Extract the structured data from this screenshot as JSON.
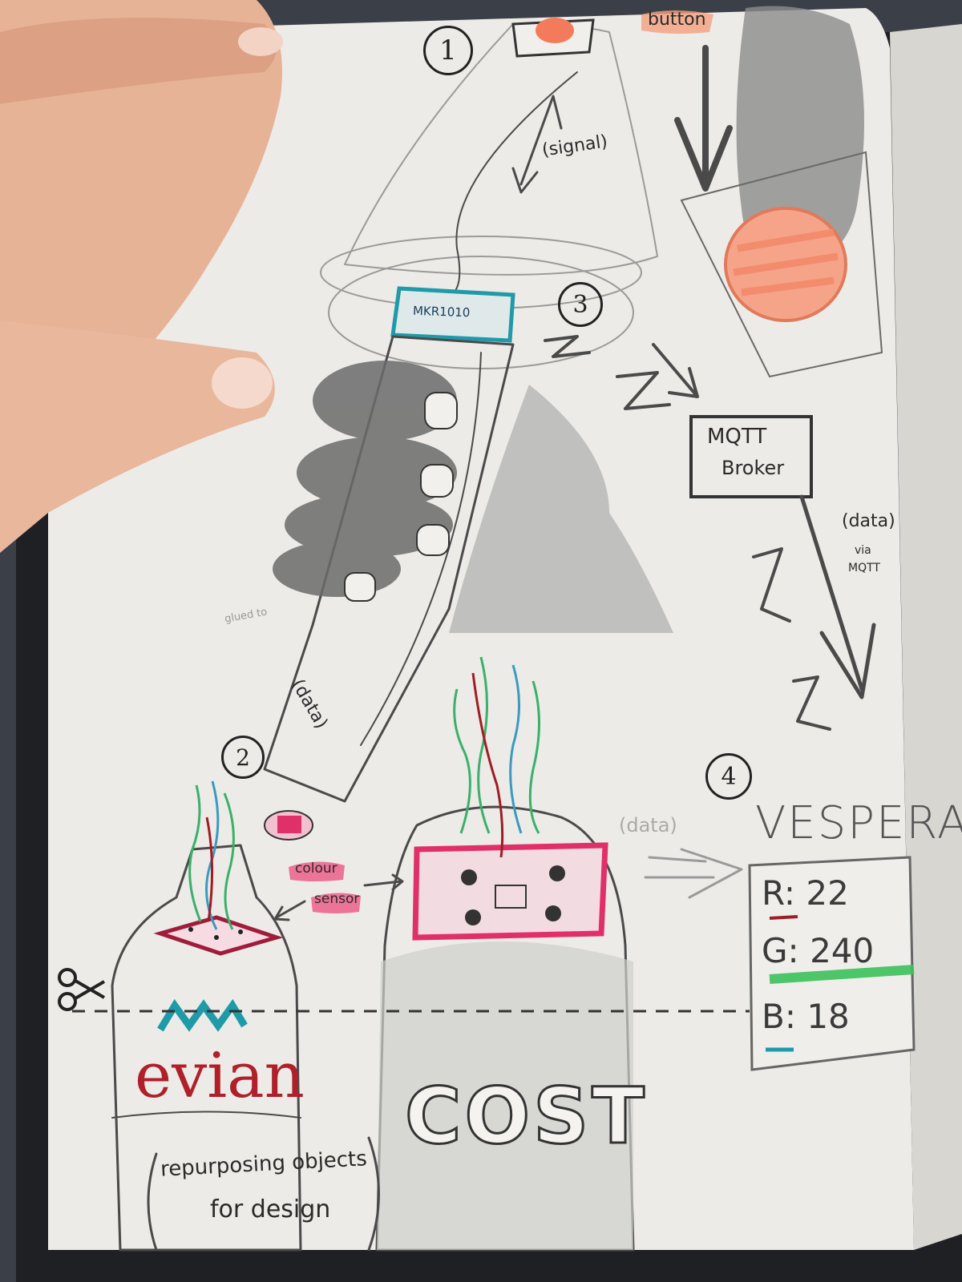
{
  "sketch": {
    "steps": [
      "1",
      "2",
      "3",
      "4"
    ],
    "labels": {
      "button": "button",
      "signal": "(signal)",
      "board": "MKR1010",
      "broker_line1": "MQTT",
      "broker_line2": "Broker",
      "data_via_mqtt_1": "(data)",
      "data_via_mqtt_2": "via",
      "data_via_mqtt_3": "MQTT",
      "data_cable": "(data)",
      "colour_sensor_1": "colour",
      "colour_sensor_2": "sensor",
      "data_to_display": "(data)",
      "glued_to": "glued to"
    },
    "display": {
      "title": "VESPERA",
      "r_label": "R:",
      "r_value": "22",
      "g_label": "G:",
      "g_value": "240",
      "b_label": "B:",
      "b_value": "18"
    },
    "bottles": {
      "brand": "evian",
      "cost_label": "COST",
      "caption_line1": "repurposing objects",
      "caption_line2": "for design"
    },
    "colors": {
      "paper": "#ecebe7",
      "button_orange": "#f28a6a",
      "sensor_pink": "#e0306a",
      "teal": "#1f9aa8",
      "green": "#3cc15a",
      "red": "#a01c24"
    }
  }
}
